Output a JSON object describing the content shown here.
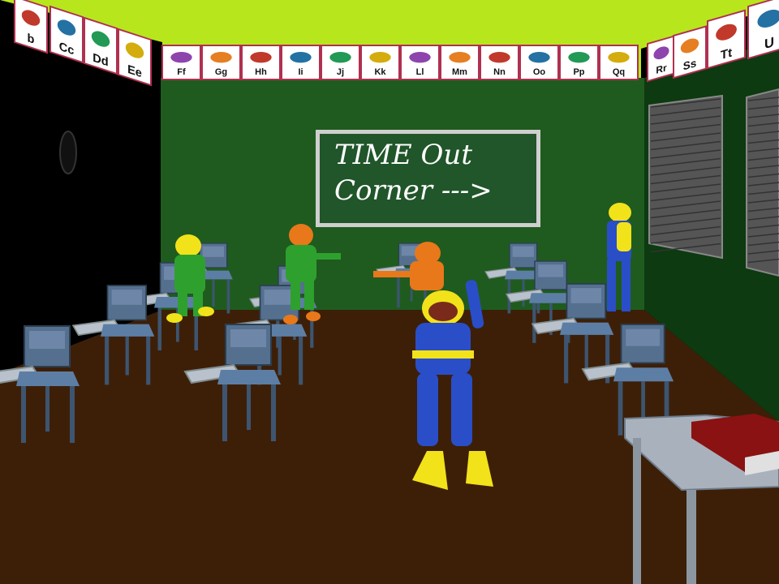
{
  "chalkboard": {
    "line1": "TIME Out",
    "line2": "Corner --->"
  },
  "alphabet_strip": [
    "b",
    "Cc",
    "Dd",
    "Ee",
    "Ff",
    "Gg",
    "Hh",
    "Ii",
    "Jj",
    "Kk",
    "Ll",
    "Mm",
    "Nn",
    "Oo",
    "Pp",
    "Qq",
    "Rr",
    "Ss",
    "Tt",
    "U"
  ],
  "colors": {
    "ceiling": "#b8e61c",
    "back_wall": "#1f5b1f",
    "right_wall": "#0d3a10",
    "floor": "#3d1f08",
    "desk": "#6e87a8",
    "chalkboard": "#21552a",
    "diver_blue": "#2a4ec8",
    "diver_yellow": "#f2e21a",
    "diver_green": "#2ea02e",
    "diver_orange": "#e8781a"
  },
  "icons": [
    "elephant-icon",
    "fish-icon",
    "owl-icon",
    "duck-icon",
    "bird-icon",
    "kangaroo-icon",
    "lion-icon",
    "moon-icon",
    "nest-icon",
    "octopus-icon",
    "pig-icon",
    "queen-icon",
    "rabbit-icon",
    "seahorse-icon",
    "tree-icon"
  ]
}
